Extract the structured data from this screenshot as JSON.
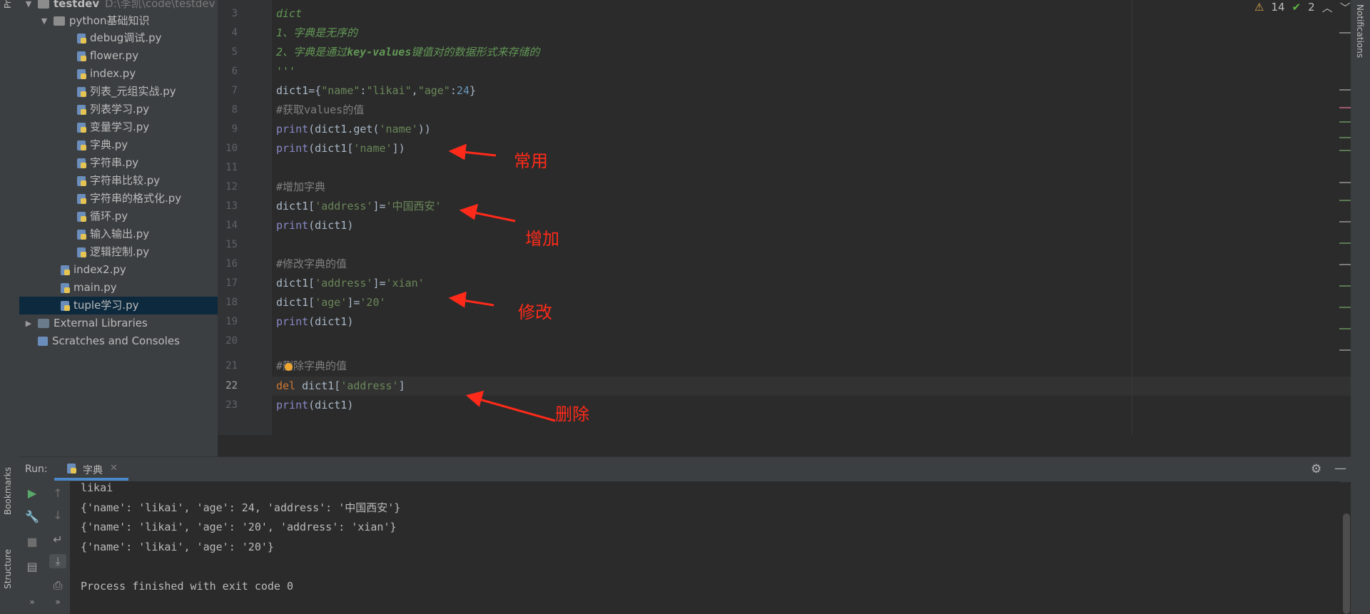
{
  "left_strip": {
    "project_tab": "Pr",
    "bookmarks_tab": "Bookmarks",
    "structure_tab": "Structure"
  },
  "project_tree": {
    "root": {
      "name": "testdev",
      "path": "D:\\李凯\\code\\testdev"
    },
    "folder": "python基础知识",
    "folder_files": [
      "debug调试.py",
      "flower.py",
      "index.py",
      "列表_元组实战.py",
      "列表学习.py",
      "变量学习.py",
      "字典.py",
      "字符串.py",
      "字符串比较.py",
      "字符串的格式化.py",
      "循环.py",
      "输入输出.py",
      "逻辑控制.py"
    ],
    "root_files": [
      "index2.py",
      "main.py",
      "tuple学习.py"
    ],
    "external_libraries": "External Libraries",
    "scratches": "Scratches and Consoles"
  },
  "editor": {
    "line_numbers": [
      "3",
      "4",
      "5",
      "6",
      "7",
      "8",
      "9",
      "10",
      "11",
      "12",
      "13",
      "14",
      "15",
      "16",
      "17",
      "18",
      "19",
      "20",
      "21",
      "22",
      "23"
    ],
    "current_line": "22",
    "indicators": {
      "warnings": "14",
      "checks": "2"
    },
    "lines": {
      "l3": "dict",
      "l4": "1、字典是无序的",
      "l5a": "2、字典是通过",
      "l5b": "key-values",
      "l5c": "键值对的数据形式来存储的",
      "l6": "'''",
      "l7_var": "dict1={",
      "l7_k1": "\"name\"",
      "l7_colon1": ":",
      "l7_v1": "\"likai\"",
      "l7_comma": ",",
      "l7_k2": "\"age\"",
      "l7_colon2": ":",
      "l7_v2": "24",
      "l7_end": "}",
      "l8": "#获取values的值",
      "l9_fn": "print",
      "l9_rest": "(dict1.get(",
      "l9_str": "'name'",
      "l9_end": "))",
      "l10_fn": "print",
      "l10_rest": "(dict1[",
      "l10_str": "'name'",
      "l10_end": "])",
      "l12": "#增加字典",
      "l13_a": "dict1[",
      "l13_s1": "'address'",
      "l13_b": "]=",
      "l13_s2": "'中国西安'",
      "l14_fn": "print",
      "l14_rest": "(dict1)",
      "l16": "#修改字典的值",
      "l17_a": "dict1[",
      "l17_s1": "'address'",
      "l17_b": "]=",
      "l17_s2": "'xian'",
      "l18_a": "dict1[",
      "l18_s1": "'age'",
      "l18_b": "]=",
      "l18_s2": "'20'",
      "l19_fn": "print",
      "l19_rest": "(dict1)",
      "l21": "#删除字典的值",
      "l22_kw": "del",
      "l22_a": " dict1[",
      "l22_s": "'address'",
      "l22_b": "]",
      "l23_fn": "print",
      "l23_rest": "(dict1)"
    }
  },
  "annotations": {
    "common": "常用",
    "add": "增加",
    "modify": "修改",
    "delete": "删除"
  },
  "run_panel": {
    "label": "Run:",
    "tab": "字典",
    "output": [
      "likai",
      "{'name': 'likai', 'age': 24, 'address': '中国西安'}",
      "{'name': 'likai', 'age': '20', 'address': 'xian'}",
      "{'name': 'likai', 'age': '20'}",
      "",
      "Process finished with exit code 0"
    ]
  },
  "right_strip": {
    "notifications": "Notifications"
  },
  "colors": {
    "annotation_red": "#ff2a1a",
    "selection": "#0d293e",
    "accent": "#4a88c7"
  }
}
